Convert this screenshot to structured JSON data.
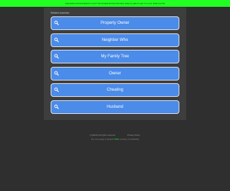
{
  "topbar": {
    "text": "hopesalerie.tierravinghacorn.com/? Get fanaaai Domain Remaxy today by glam to get it on your. Ends tue link"
  },
  "panel": {
    "title": "Related searches",
    "searches": [
      {
        "label": "Property Owner"
      },
      {
        "label": "Neighbor Who"
      },
      {
        "label": "My Family Tree"
      },
      {
        "label": "Owner"
      },
      {
        "label": "Cheating"
      },
      {
        "label": "Husband"
      }
    ]
  },
  "footer": {
    "copyright": "(c)(2024) All rights reserved",
    "privacy": "Privacy Policy",
    "note_prefix": "Our very page is parked ",
    "note_link": "FREE",
    "note_suffix": " courtesy of GoDaddy"
  },
  "colors": {
    "topbar": "#22ff22",
    "button": "#4b8be9",
    "background": "#2f2f2f",
    "panel": "#3e3e3e"
  },
  "icons": [
    "magnifier-icon"
  ]
}
